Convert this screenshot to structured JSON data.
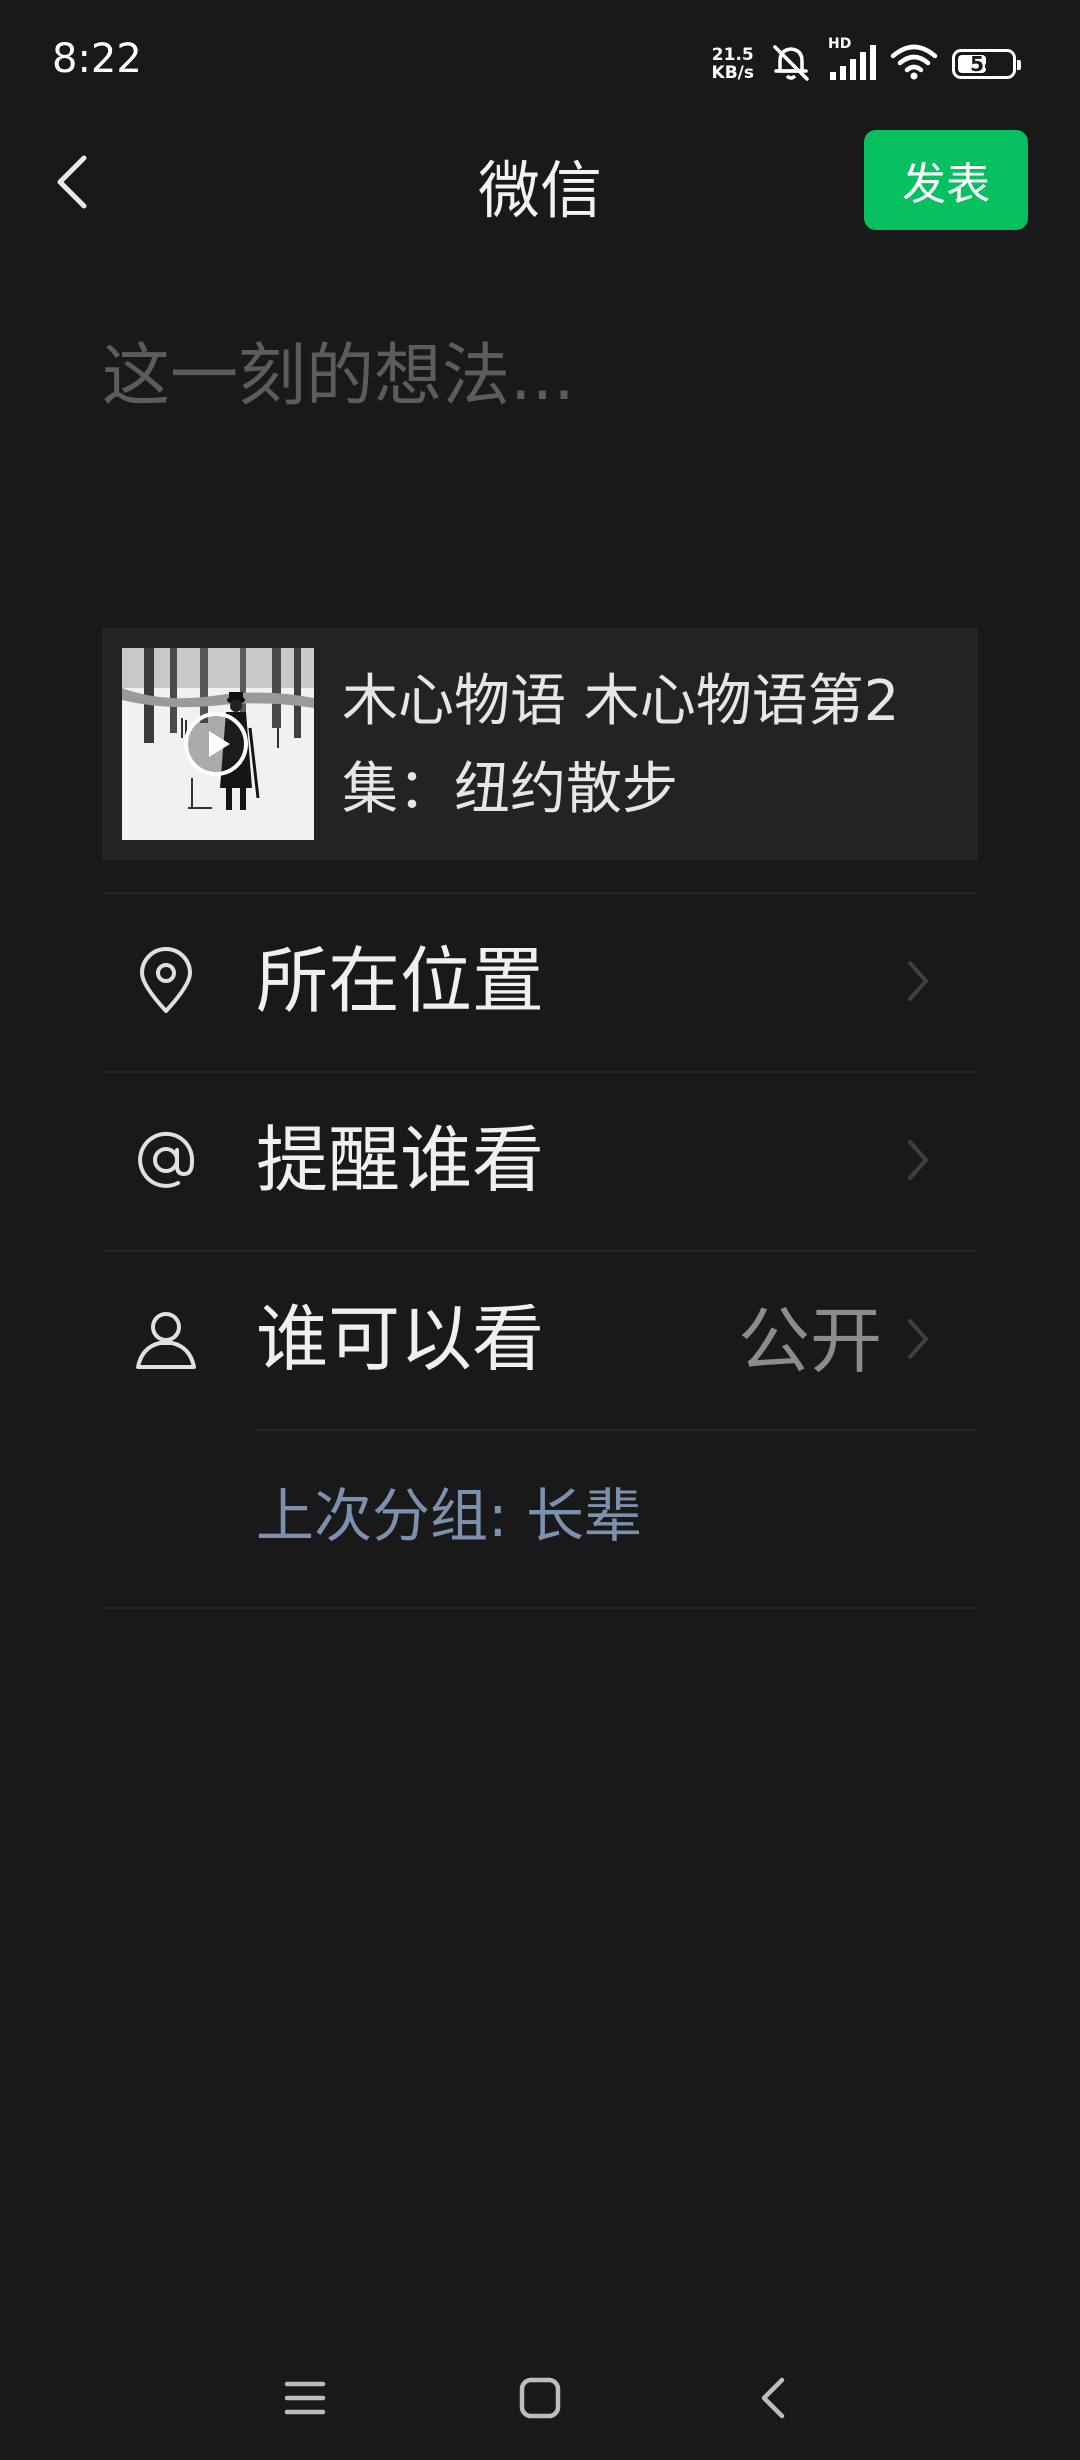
{
  "status_bar": {
    "time": "8:22",
    "net_speed_value": "21.5",
    "net_speed_unit": "KB/s",
    "signal_label": "HD",
    "battery_level": "54",
    "battery_fraction": 0.54
  },
  "nav": {
    "title": "微信",
    "publish_label": "发表",
    "back_icon": "chevron-left-icon"
  },
  "composer": {
    "placeholder": "这一刻的想法..."
  },
  "shared_item": {
    "title": "木心物语 木心物语第2集：纽约散步",
    "cover_icon": "play-icon"
  },
  "options": {
    "location": {
      "label": "所在位置",
      "icon": "location-pin-icon"
    },
    "remind": {
      "label": "提醒谁看",
      "icon": "at-sign-icon"
    },
    "visibility": {
      "label": "谁可以看",
      "value": "公开",
      "icon": "person-icon"
    },
    "last_group": "上次分组: 长辈"
  },
  "colors": {
    "background": "#191919",
    "accent_green": "#07c160",
    "link_blue": "#7c90b0"
  }
}
